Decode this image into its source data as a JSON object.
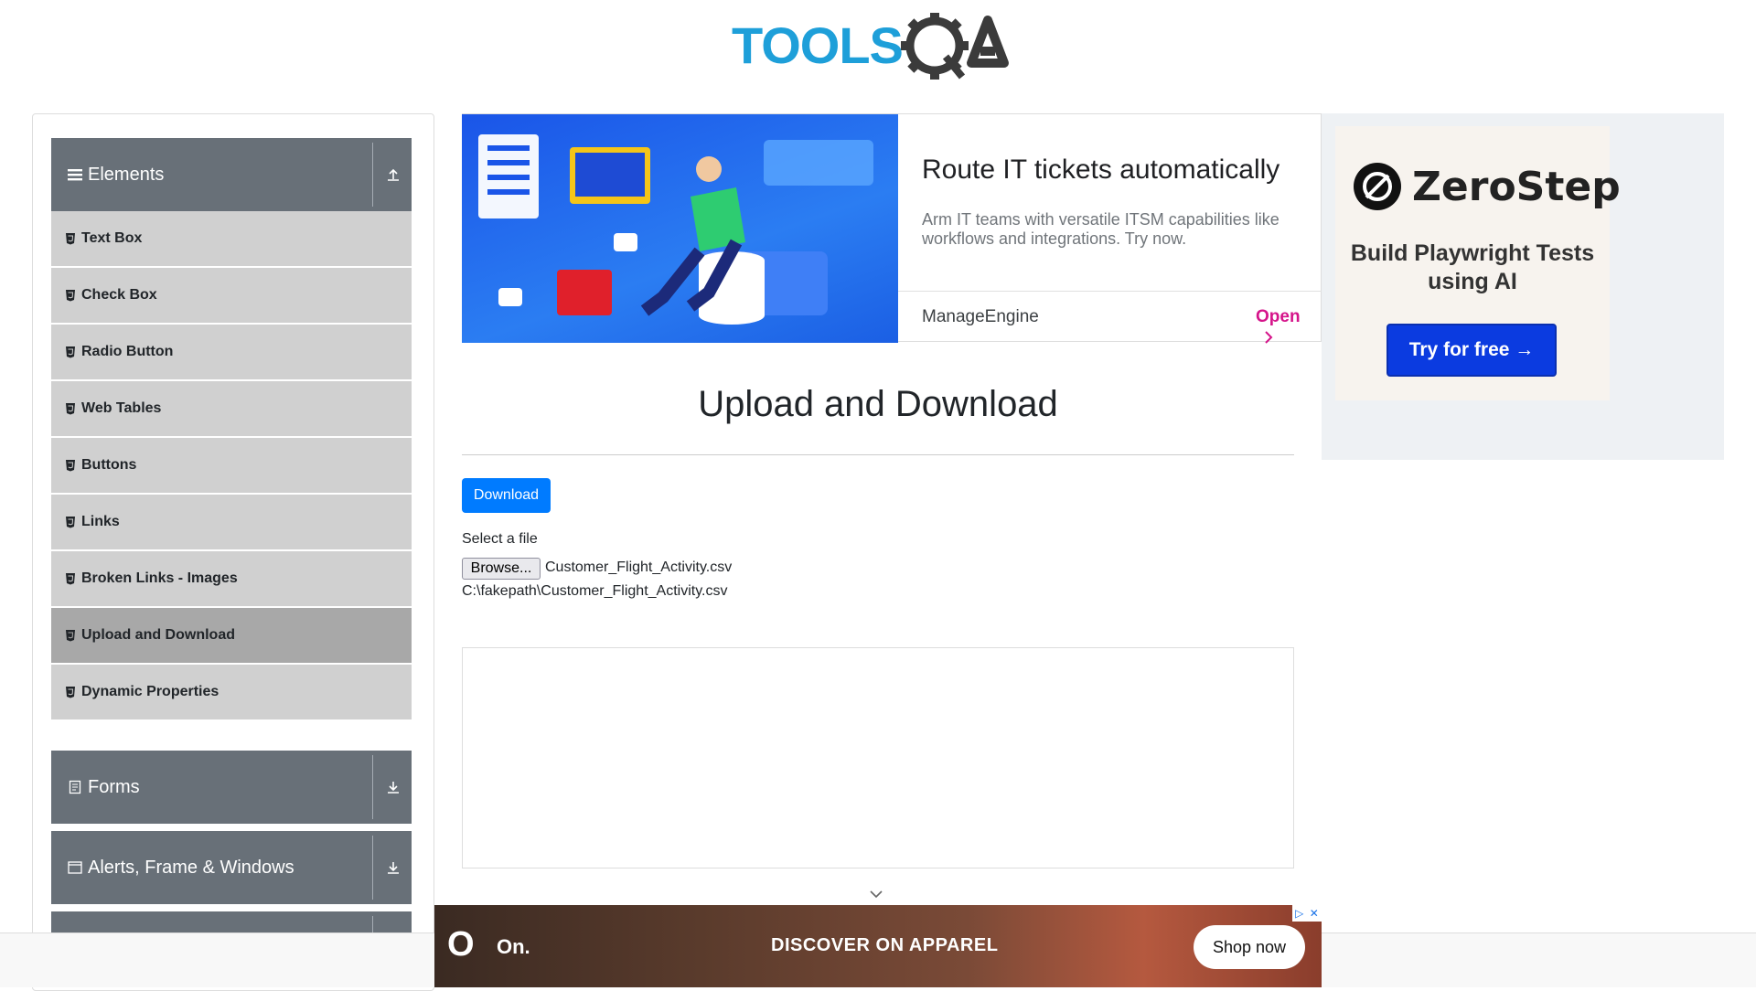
{
  "sidebar": {
    "elements_group": {
      "title": "Elements"
    },
    "items": [
      {
        "label": "Text Box"
      },
      {
        "label": "Check Box"
      },
      {
        "label": "Radio Button"
      },
      {
        "label": "Web Tables"
      },
      {
        "label": "Buttons"
      },
      {
        "label": "Links"
      },
      {
        "label": "Broken Links - Images"
      },
      {
        "label": "Upload and Download",
        "active": true
      },
      {
        "label": "Dynamic Properties"
      }
    ],
    "forms_group": {
      "title": "Forms"
    },
    "alerts_group": {
      "title": "Alerts, Frame & Windows"
    }
  },
  "ad_top": {
    "headline": "Route IT tickets automatically",
    "description": "Arm IT teams with versatile ITSM capabilities like workflows and integrations. Try now.",
    "brand": "ManageEngine",
    "cta": "Open",
    "cta_color": "#d5148a"
  },
  "ad_side": {
    "brand": "ZeroStep",
    "tagline": "Build Playwright Tests using AI",
    "cta": "Try for free →",
    "cta_color": "#0b3be0"
  },
  "main": {
    "title": "Upload and Download",
    "download_label": "Download",
    "select_label": "Select a file",
    "browse_label": "Browse...",
    "file_name": "Customer_Flight_Activity.csv",
    "uploaded_path": "C:\\fakepath\\Customer_Flight_Activity.csv"
  },
  "ad_bottom": {
    "brand": "On.",
    "headline": "DISCOVER ON APPAREL",
    "cta": "Shop now"
  },
  "colors": {
    "primary_button": "#007bff",
    "group_header": "#687078",
    "menu_item": "#d0d0d0",
    "menu_item_active": "#a8a8a8"
  }
}
